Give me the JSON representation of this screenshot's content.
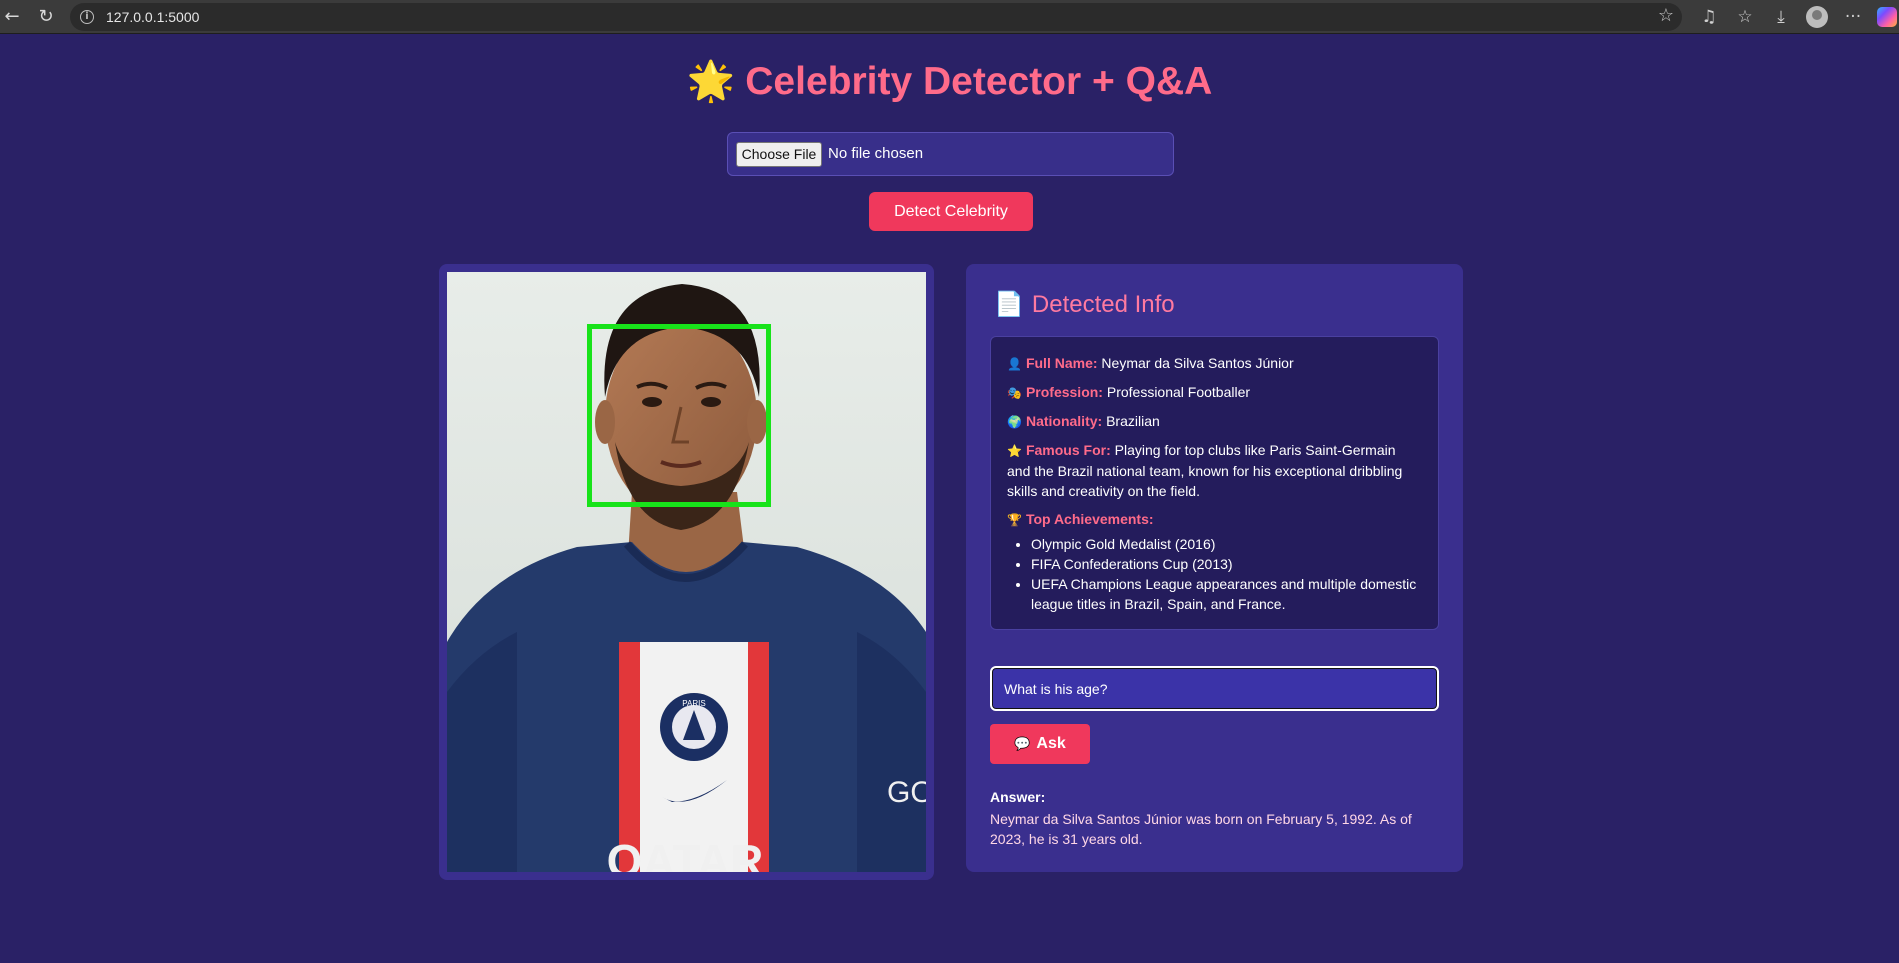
{
  "browser": {
    "url": "127.0.0.1:5000"
  },
  "header": {
    "emoji": "🌟",
    "title": "Celebrity Detector + Q&A"
  },
  "upload": {
    "button_label": "Choose File",
    "status": "No file chosen"
  },
  "detect_button": "Detect Celebrity",
  "photo": {
    "jersey_crest": "PARIS",
    "jersey_sponsor": "QATAR",
    "sleeve_text": "GO"
  },
  "info": {
    "icon": "📄",
    "title": "Detected Info",
    "full_name": {
      "icon": "👤",
      "label": "Full Name:",
      "value": "Neymar da Silva Santos Júnior"
    },
    "profession": {
      "icon": "🎭",
      "label": "Profession:",
      "value": "Professional Footballer"
    },
    "nationality": {
      "icon": "🌍",
      "label": "Nationality:",
      "value": "Brazilian"
    },
    "famous_for": {
      "icon": "⭐",
      "label": "Famous For:",
      "value": "Playing for top clubs like Paris Saint-Germain and the Brazil national team, known for his exceptional dribbling skills and creativity on the field."
    },
    "achievements": {
      "icon": "🏆",
      "label": "Top Achievements:",
      "items": [
        "Olympic Gold Medalist (2016)",
        "FIFA Confederations Cup (2013)",
        "UEFA Champions League appearances and multiple domestic league titles in Brazil, Spain, and France."
      ]
    }
  },
  "qa": {
    "question_value": "What is his age?",
    "ask_icon": "💬",
    "ask_label": "Ask",
    "answer_label": "Answer:",
    "answer_text": "Neymar da Silva Santos Júnior was born on February 5, 1992. As of 2023, he is 31 years old."
  },
  "colors": {
    "background": "#2a2166",
    "accent": "#ff6b8a",
    "button": "#f0385c",
    "panel": "#3a2f8e",
    "face_box": "#18e31a"
  }
}
